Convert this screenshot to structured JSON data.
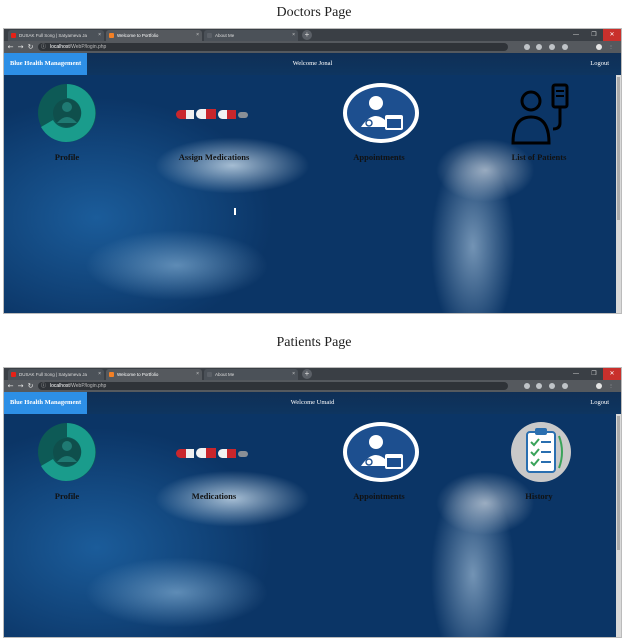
{
  "captions": {
    "doctors": "Doctors Page",
    "patients": "Patients Page"
  },
  "browser": {
    "tabs": [
      "DUSAK Full Song | Satyameva Ja",
      "Welcome to Portfolio",
      "About Me"
    ],
    "tab_close": "×",
    "new_tab": "+",
    "address_host": "localhost",
    "doctors_path": "/WebP/login.php",
    "patients_path": "/WebP/login.php",
    "window_controls": [
      "—",
      "❐",
      "✕"
    ],
    "favicon_colors": [
      "#e62117",
      "#f48024",
      "#5b6067"
    ]
  },
  "doctors": {
    "brand": "Blue Health Management",
    "welcome": "Welcome Jonal",
    "logout": "Logout",
    "tiles": [
      "Profile",
      "Assign Medications",
      "Appointments",
      "List of Patients"
    ]
  },
  "patients": {
    "brand": "Blue Health Management",
    "welcome": "Welcome Umaid",
    "logout": "Logout",
    "tiles": [
      "Profile",
      "Medications",
      "Appointments",
      "History"
    ]
  },
  "icons": {
    "profile": "profile-ring-icon",
    "medications": "pills-icon",
    "appointments": "doctor-calendar-icon",
    "patients": "patient-iv-icon",
    "history": "clipboard-checklist-icon"
  },
  "colors": {
    "brand_bg": "#2d8fe6",
    "nav_bg": "#0f2f56",
    "teal": "#1a9c8c",
    "appt_blue": "#1d4f8f"
  }
}
